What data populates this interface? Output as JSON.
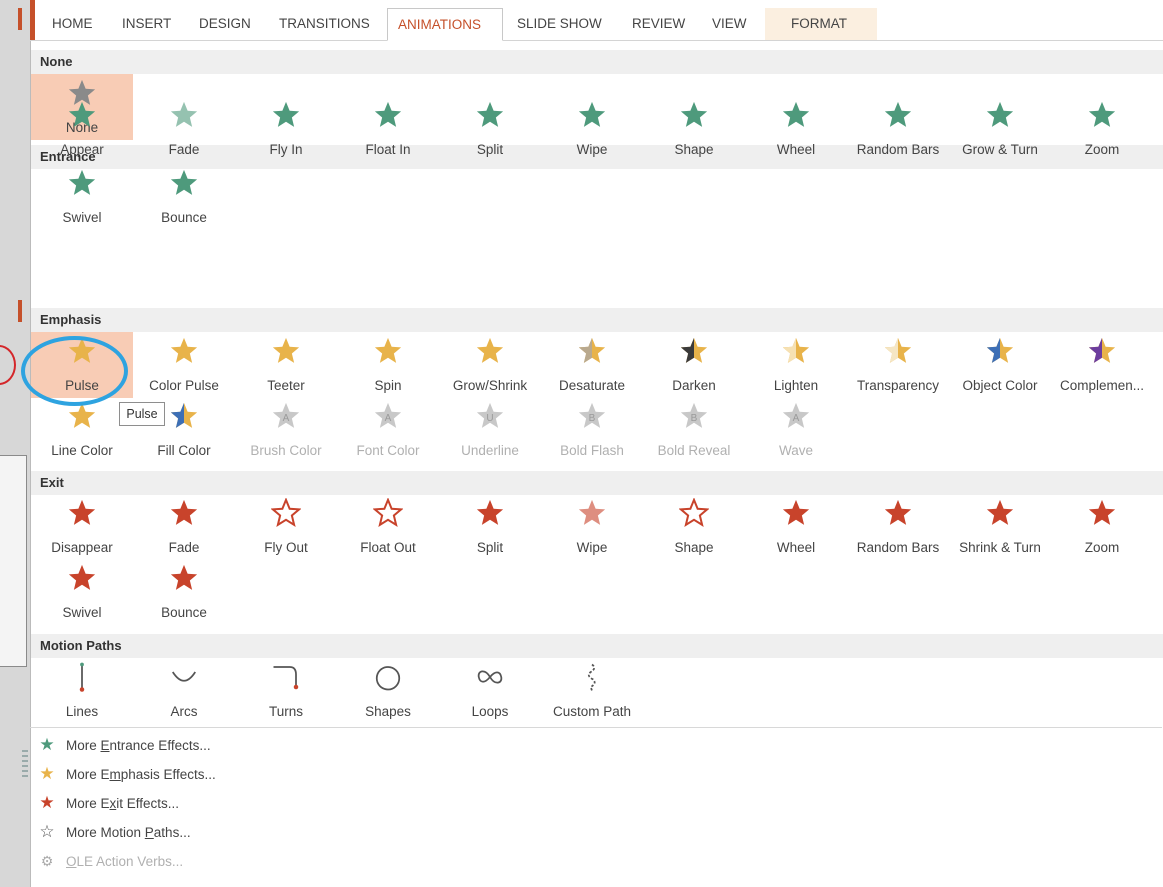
{
  "ribbon": {
    "tabs": [
      {
        "label": "HOME"
      },
      {
        "label": "INSERT"
      },
      {
        "label": "DESIGN"
      },
      {
        "label": "TRANSITIONS"
      },
      {
        "label": "ANIMATIONS",
        "active": true
      },
      {
        "label": "SLIDE SHOW"
      },
      {
        "label": "REVIEW"
      },
      {
        "label": "VIEW"
      },
      {
        "label": "FORMAT"
      }
    ]
  },
  "colors": {
    "entrance": "#4e9a7c",
    "emphasis": "#e8b34a",
    "exit": "#c8432b",
    "none": "#8a8a8a",
    "accent": "#c5502a",
    "selection_ring": "#2ea3e0",
    "selected_tile": "#f8ccb5"
  },
  "sections": {
    "none": {
      "title": "None",
      "items": [
        {
          "label": "None",
          "icon": "gray-star-icon"
        }
      ]
    },
    "entrance": {
      "title": "Entrance",
      "items": [
        {
          "label": "Appear",
          "icon": "appear-star-icon"
        },
        {
          "label": "Fade",
          "icon": "fade-star-icon"
        },
        {
          "label": "Fly In",
          "icon": "fly-in-star-icon"
        },
        {
          "label": "Float In",
          "icon": "float-in-star-icon"
        },
        {
          "label": "Split",
          "icon": "split-star-icon"
        },
        {
          "label": "Wipe",
          "icon": "wipe-star-icon"
        },
        {
          "label": "Shape",
          "icon": "shape-star-icon"
        },
        {
          "label": "Wheel",
          "icon": "wheel-star-icon"
        },
        {
          "label": "Random Bars",
          "icon": "random-bars-star-icon"
        },
        {
          "label": "Grow & Turn",
          "icon": "grow-turn-star-icon"
        },
        {
          "label": "Zoom",
          "icon": "zoom-star-icon"
        },
        {
          "label": "Swivel",
          "icon": "swivel-star-icon"
        },
        {
          "label": "Bounce",
          "icon": "bounce-star-icon"
        }
      ]
    },
    "emphasis": {
      "title": "Emphasis",
      "items": [
        {
          "label": "Pulse",
          "icon": "pulse-star-icon",
          "selected": true
        },
        {
          "label": "Color Pulse",
          "icon": "color-pulse-star-icon"
        },
        {
          "label": "Teeter",
          "icon": "teeter-star-icon"
        },
        {
          "label": "Spin",
          "icon": "spin-star-icon"
        },
        {
          "label": "Grow/Shrink",
          "icon": "grow-shrink-star-icon"
        },
        {
          "label": "Desaturate",
          "icon": "desaturate-star-icon"
        },
        {
          "label": "Darken",
          "icon": "darken-star-icon"
        },
        {
          "label": "Lighten",
          "icon": "lighten-star-icon"
        },
        {
          "label": "Transparency",
          "icon": "transparency-star-icon"
        },
        {
          "label": "Object Color",
          "icon": "object-color-star-icon"
        },
        {
          "label": "Complemen...",
          "icon": "complementary-color-star-icon"
        },
        {
          "label": "Line Color",
          "icon": "line-color-star-icon"
        },
        {
          "label": "Fill Color",
          "icon": "fill-color-star-icon"
        },
        {
          "label": "Brush Color",
          "icon": "brush-color-star-icon",
          "disabled": true
        },
        {
          "label": "Font Color",
          "icon": "font-color-star-icon",
          "disabled": true
        },
        {
          "label": "Underline",
          "icon": "underline-star-icon",
          "disabled": true
        },
        {
          "label": "Bold Flash",
          "icon": "bold-flash-star-icon",
          "disabled": true
        },
        {
          "label": "Bold Reveal",
          "icon": "bold-reveal-star-icon",
          "disabled": true
        },
        {
          "label": "Wave",
          "icon": "wave-star-icon",
          "disabled": true
        }
      ]
    },
    "exit": {
      "title": "Exit",
      "items": [
        {
          "label": "Disappear",
          "icon": "disappear-star-icon"
        },
        {
          "label": "Fade",
          "icon": "fade-out-star-icon"
        },
        {
          "label": "Fly Out",
          "icon": "fly-out-star-icon"
        },
        {
          "label": "Float Out",
          "icon": "float-out-star-icon"
        },
        {
          "label": "Split",
          "icon": "split-out-star-icon"
        },
        {
          "label": "Wipe",
          "icon": "wipe-out-star-icon"
        },
        {
          "label": "Shape",
          "icon": "shape-out-star-icon"
        },
        {
          "label": "Wheel",
          "icon": "wheel-out-star-icon"
        },
        {
          "label": "Random Bars",
          "icon": "random-bars-out-star-icon"
        },
        {
          "label": "Shrink & Turn",
          "icon": "shrink-turn-star-icon"
        },
        {
          "label": "Zoom",
          "icon": "zoom-out-star-icon"
        },
        {
          "label": "Swivel",
          "icon": "swivel-out-star-icon"
        },
        {
          "label": "Bounce",
          "icon": "bounce-out-star-icon"
        }
      ]
    },
    "motion": {
      "title": "Motion Paths",
      "items": [
        {
          "label": "Lines",
          "icon": "line-path-icon"
        },
        {
          "label": "Arcs",
          "icon": "arc-path-icon"
        },
        {
          "label": "Turns",
          "icon": "turn-path-icon"
        },
        {
          "label": "Shapes",
          "icon": "circle-path-icon"
        },
        {
          "label": "Loops",
          "icon": "loop-path-icon"
        },
        {
          "label": "Custom Path",
          "icon": "custom-path-icon"
        }
      ]
    }
  },
  "tooltip": "Pulse",
  "more_links": [
    {
      "pre": "More ",
      "ul": "E",
      "post": "ntrance Effects...",
      "icon": "green-star-icon"
    },
    {
      "pre": "More E",
      "ul": "m",
      "post": "phasis Effects...",
      "icon": "gold-star-icon"
    },
    {
      "pre": "More E",
      "ul": "x",
      "post": "it Effects...",
      "icon": "red-star-icon"
    },
    {
      "pre": "More Motion ",
      "ul": "P",
      "post": "aths...",
      "icon": "outline-star-icon"
    },
    {
      "pre": "",
      "ul": "O",
      "post": "LE Action Verbs...",
      "icon": "gears-icon",
      "disabled": true
    }
  ]
}
